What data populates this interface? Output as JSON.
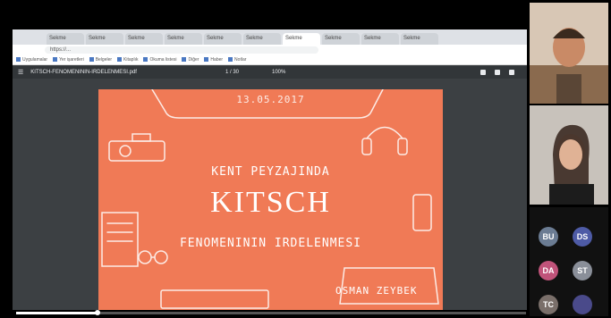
{
  "browser": {
    "tabs": [
      "Sekme",
      "Sekme",
      "Sekme",
      "Sekme",
      "Sekme",
      "Sekme",
      "Sekme",
      "Sekme",
      "Sekme",
      "Sekme"
    ],
    "active_tab_index": 6,
    "address": "https://...",
    "bookmarks": [
      "Uygulamalar",
      "Yer işaretleri",
      "Belgeler",
      "Kitaplık",
      "Okuma listesi",
      "Diğer",
      "Haber",
      "Notlar"
    ]
  },
  "viewer": {
    "title": "KITSCH-FENOMENININ-IRDELENMESI.pdf",
    "page": "1 / 30",
    "zoom": "100%"
  },
  "slide": {
    "date": "13.05.2017",
    "subtitle1": "KENT PEYZAJINDA",
    "title": "KITSCH",
    "subtitle2": "FENOMENININ IRDELENMESI",
    "author": "OSMAN ZEYBEK",
    "colors": {
      "background": "#f07a56",
      "lines": "#ffffff"
    }
  },
  "video": {
    "progress": 0.16
  },
  "participants": [
    {
      "initials": "BU",
      "name": "",
      "color": "#6b7c93"
    },
    {
      "initials": "DS",
      "name": "",
      "color": "#4e5ba6"
    },
    {
      "initials": "DA",
      "name": "",
      "color": "#c0537a"
    },
    {
      "initials": "ST",
      "name": "",
      "color": "#8a8f99"
    },
    {
      "initials": "TC",
      "name": "",
      "color": "#7a6f6a"
    },
    {
      "initials": "",
      "name": "",
      "color": "#4a4a8a"
    }
  ]
}
